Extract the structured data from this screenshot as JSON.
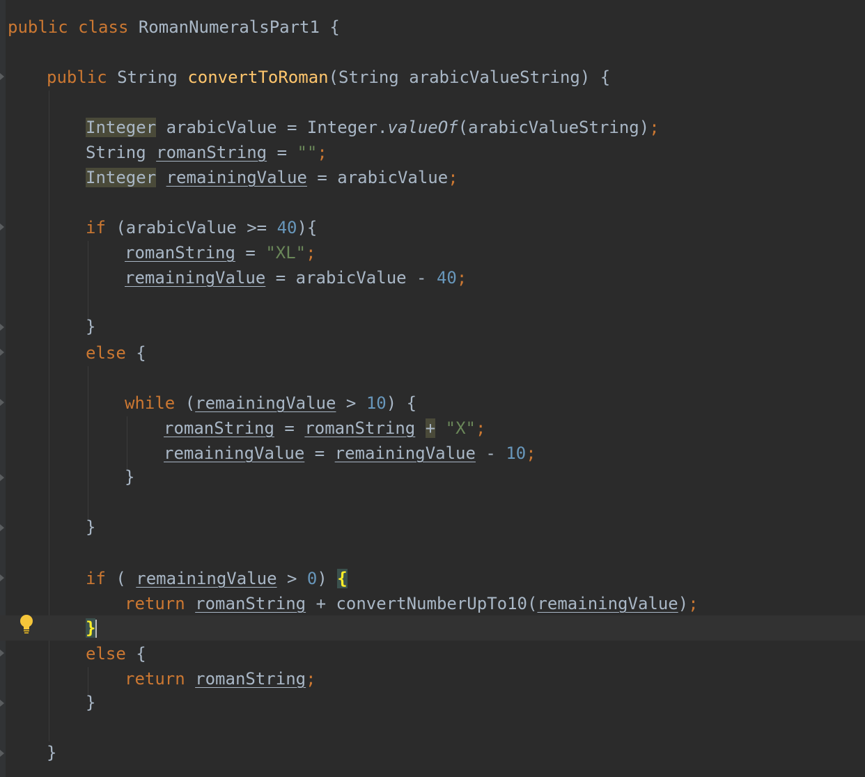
{
  "editor": {
    "theme_colors": {
      "background": "#2b2b2b",
      "keyword": "#cc7832",
      "method": "#ffc66d",
      "string": "#6a8759",
      "number": "#6897bb",
      "text": "#a9b7c6"
    },
    "intention_icon": "lightbulb-icon",
    "lines": [
      {
        "t": [
          "public",
          "class",
          "RomanNumeralsPart1",
          "{"
        ]
      },
      {
        "t": [
          "public",
          "String",
          "convertToRoman",
          "(String arabicValueString) {"
        ]
      },
      {
        "t": [
          "Integer",
          "arabicValue = Integer.",
          "valueOf",
          "(arabicValueString)",
          ";"
        ]
      },
      {
        "t": [
          "String",
          "romanString",
          "=",
          "\"\"",
          ";"
        ]
      },
      {
        "t": [
          "Integer",
          "remainingValue",
          "= arabicValue",
          ";"
        ]
      },
      {
        "t": [
          "if",
          "(arabicValue >=",
          "40",
          "){"
        ]
      },
      {
        "t": [
          "romanString",
          "=",
          "\"XL\"",
          ";"
        ]
      },
      {
        "t": [
          "remainingValue",
          "= arabicValue -",
          "40",
          ";"
        ]
      },
      {
        "t": [
          "}"
        ]
      },
      {
        "t": [
          "else",
          "{"
        ]
      },
      {
        "t": [
          "while",
          "(",
          "remainingValue",
          ">",
          "10",
          ") {"
        ]
      },
      {
        "t": [
          "romanString",
          "=",
          "romanString",
          "+",
          "\"X\"",
          ";"
        ]
      },
      {
        "t": [
          "remainingValue",
          "=",
          "remainingValue",
          "-",
          "10",
          ";"
        ]
      },
      {
        "t": [
          "}"
        ]
      },
      {
        "t": [
          "}"
        ]
      },
      {
        "t": [
          "if",
          "(",
          "remainingValue",
          ">",
          "0",
          ")",
          "{"
        ]
      },
      {
        "t": [
          "return",
          "romanString",
          "+ convertNumberUpTo10(",
          "remainingValue",
          ")",
          ";"
        ]
      },
      {
        "t": [
          "}"
        ]
      },
      {
        "t": [
          "else",
          "{"
        ]
      },
      {
        "t": [
          "return",
          "romanString",
          ";"
        ]
      },
      {
        "t": [
          "}"
        ]
      },
      {
        "t": [
          "}"
        ]
      }
    ]
  }
}
